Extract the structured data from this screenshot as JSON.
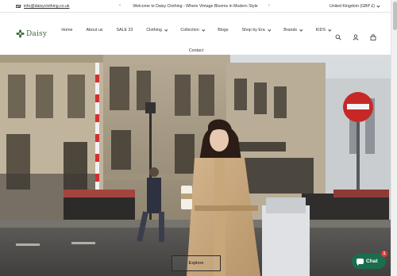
{
  "announcement": {
    "email": "info@daisyclothing.co.uk",
    "message": "Welcome to Daisy Clothing - Where Vintage Blooms in Modern Style",
    "region": "United Kingdom (GBP £)"
  },
  "brand": {
    "name": "Daisy"
  },
  "nav": {
    "items": [
      "Home",
      "About us",
      "SALE 23",
      "Clothing",
      "Collection",
      "Blogs",
      "Shop by Era",
      "Brands",
      "KIDS",
      "Contact"
    ]
  },
  "hero": {
    "button_label": "Explore"
  },
  "chat": {
    "label": "Chat",
    "unread": "1"
  },
  "colors": {
    "brand_green": "#3f6b3f",
    "chat_green": "#1a6e4e"
  }
}
